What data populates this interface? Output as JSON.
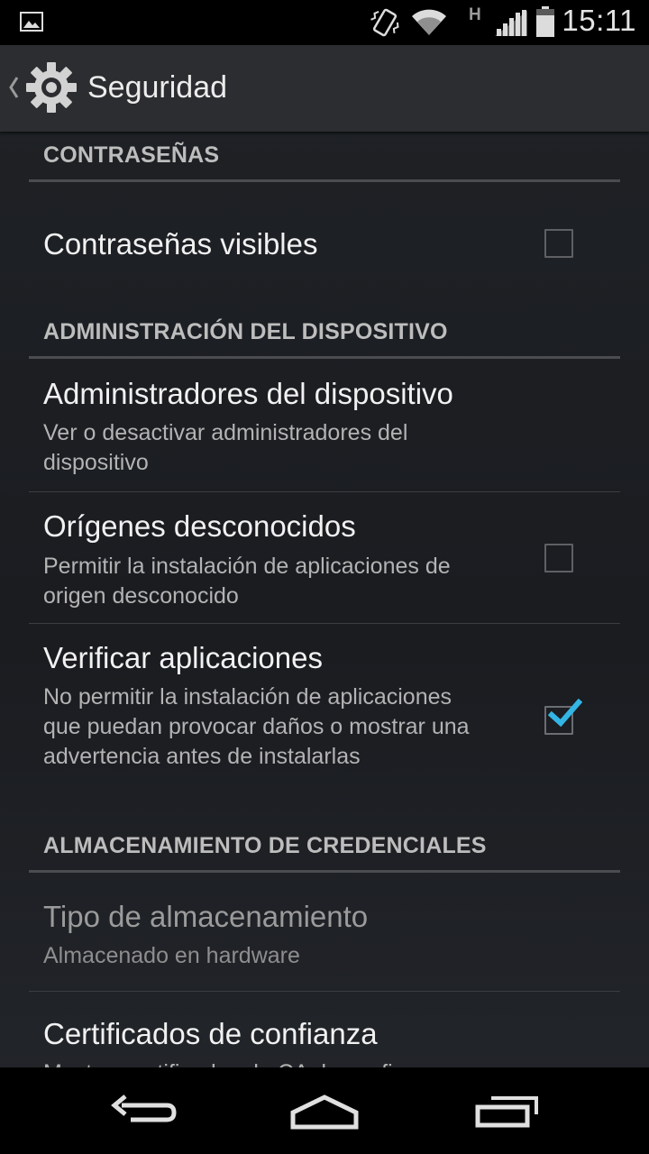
{
  "status_bar": {
    "network_type": "H",
    "time": "15:11",
    "icons": [
      "gallery-icon",
      "vibrate-icon",
      "wifi-icon",
      "signal-icon",
      "battery-icon"
    ]
  },
  "action_bar": {
    "title": "Seguridad",
    "icons": [
      "back-chevron-icon",
      "gear-icon"
    ]
  },
  "sections": {
    "passwords": {
      "header": "CONTRASEÑAS",
      "visible_passwords": {
        "title": "Contraseñas visibles",
        "checked": false
      }
    },
    "device_admin": {
      "header": "ADMINISTRACIÓN DEL DISPOSITIVO",
      "device_administrators": {
        "title": "Administradores del dispositivo",
        "summary": "Ver o desactivar administradores del dispositivo"
      },
      "unknown_sources": {
        "title": "Orígenes desconocidos",
        "summary": "Permitir la instalación de aplicaciones de origen desconocido",
        "checked": false
      },
      "verify_apps": {
        "title": "Verificar aplicaciones",
        "summary": "No permitir la instalación de aplicaciones que puedan provocar daños o mostrar una advertencia antes de instalarlas",
        "checked": true
      }
    },
    "credential_storage": {
      "header": "ALMACENAMIENTO DE CREDENCIALES",
      "storage_type": {
        "title": "Tipo de almacenamiento",
        "summary": "Almacenado en hardware",
        "enabled": false
      },
      "trusted_credentials": {
        "title": "Certificados de confianza",
        "summary": "Mostrar certificados de CA de confianza"
      }
    }
  },
  "nav_bar": {
    "icons": [
      "back-icon",
      "home-icon",
      "recent-apps-icon"
    ]
  },
  "colors": {
    "accent": "#33b5e5",
    "action_bar": "#2c2d30",
    "background": "#1f2226"
  }
}
